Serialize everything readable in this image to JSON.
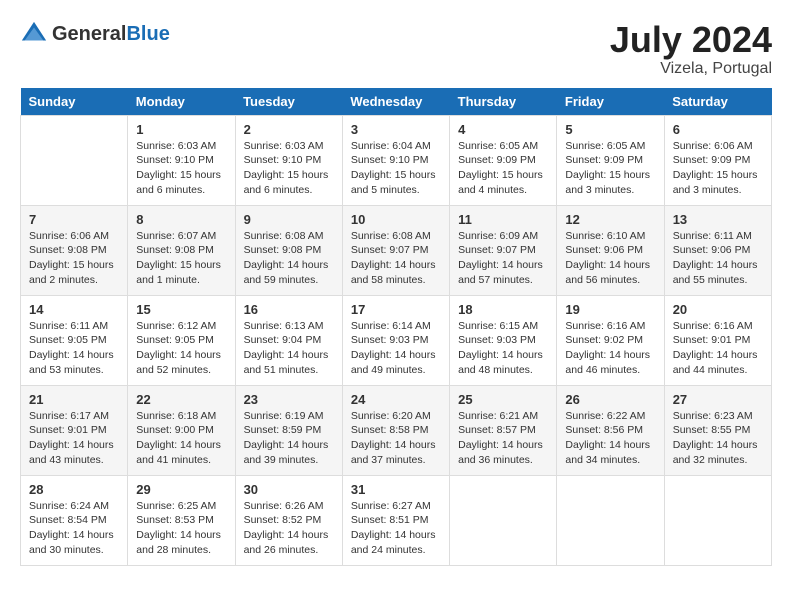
{
  "header": {
    "logo_general": "General",
    "logo_blue": "Blue",
    "month_year": "July 2024",
    "location": "Vizela, Portugal"
  },
  "weekdays": [
    "Sunday",
    "Monday",
    "Tuesday",
    "Wednesday",
    "Thursday",
    "Friday",
    "Saturday"
  ],
  "weeks": [
    [
      {
        "day": "",
        "info": ""
      },
      {
        "day": "1",
        "info": "Sunrise: 6:03 AM\nSunset: 9:10 PM\nDaylight: 15 hours\nand 6 minutes."
      },
      {
        "day": "2",
        "info": "Sunrise: 6:03 AM\nSunset: 9:10 PM\nDaylight: 15 hours\nand 6 minutes."
      },
      {
        "day": "3",
        "info": "Sunrise: 6:04 AM\nSunset: 9:10 PM\nDaylight: 15 hours\nand 5 minutes."
      },
      {
        "day": "4",
        "info": "Sunrise: 6:05 AM\nSunset: 9:09 PM\nDaylight: 15 hours\nand 4 minutes."
      },
      {
        "day": "5",
        "info": "Sunrise: 6:05 AM\nSunset: 9:09 PM\nDaylight: 15 hours\nand 3 minutes."
      },
      {
        "day": "6",
        "info": "Sunrise: 6:06 AM\nSunset: 9:09 PM\nDaylight: 15 hours\nand 3 minutes."
      }
    ],
    [
      {
        "day": "7",
        "info": "Sunrise: 6:06 AM\nSunset: 9:08 PM\nDaylight: 15 hours\nand 2 minutes."
      },
      {
        "day": "8",
        "info": "Sunrise: 6:07 AM\nSunset: 9:08 PM\nDaylight: 15 hours\nand 1 minute."
      },
      {
        "day": "9",
        "info": "Sunrise: 6:08 AM\nSunset: 9:08 PM\nDaylight: 14 hours\nand 59 minutes."
      },
      {
        "day": "10",
        "info": "Sunrise: 6:08 AM\nSunset: 9:07 PM\nDaylight: 14 hours\nand 58 minutes."
      },
      {
        "day": "11",
        "info": "Sunrise: 6:09 AM\nSunset: 9:07 PM\nDaylight: 14 hours\nand 57 minutes."
      },
      {
        "day": "12",
        "info": "Sunrise: 6:10 AM\nSunset: 9:06 PM\nDaylight: 14 hours\nand 56 minutes."
      },
      {
        "day": "13",
        "info": "Sunrise: 6:11 AM\nSunset: 9:06 PM\nDaylight: 14 hours\nand 55 minutes."
      }
    ],
    [
      {
        "day": "14",
        "info": "Sunrise: 6:11 AM\nSunset: 9:05 PM\nDaylight: 14 hours\nand 53 minutes."
      },
      {
        "day": "15",
        "info": "Sunrise: 6:12 AM\nSunset: 9:05 PM\nDaylight: 14 hours\nand 52 minutes."
      },
      {
        "day": "16",
        "info": "Sunrise: 6:13 AM\nSunset: 9:04 PM\nDaylight: 14 hours\nand 51 minutes."
      },
      {
        "day": "17",
        "info": "Sunrise: 6:14 AM\nSunset: 9:03 PM\nDaylight: 14 hours\nand 49 minutes."
      },
      {
        "day": "18",
        "info": "Sunrise: 6:15 AM\nSunset: 9:03 PM\nDaylight: 14 hours\nand 48 minutes."
      },
      {
        "day": "19",
        "info": "Sunrise: 6:16 AM\nSunset: 9:02 PM\nDaylight: 14 hours\nand 46 minutes."
      },
      {
        "day": "20",
        "info": "Sunrise: 6:16 AM\nSunset: 9:01 PM\nDaylight: 14 hours\nand 44 minutes."
      }
    ],
    [
      {
        "day": "21",
        "info": "Sunrise: 6:17 AM\nSunset: 9:01 PM\nDaylight: 14 hours\nand 43 minutes."
      },
      {
        "day": "22",
        "info": "Sunrise: 6:18 AM\nSunset: 9:00 PM\nDaylight: 14 hours\nand 41 minutes."
      },
      {
        "day": "23",
        "info": "Sunrise: 6:19 AM\nSunset: 8:59 PM\nDaylight: 14 hours\nand 39 minutes."
      },
      {
        "day": "24",
        "info": "Sunrise: 6:20 AM\nSunset: 8:58 PM\nDaylight: 14 hours\nand 37 minutes."
      },
      {
        "day": "25",
        "info": "Sunrise: 6:21 AM\nSunset: 8:57 PM\nDaylight: 14 hours\nand 36 minutes."
      },
      {
        "day": "26",
        "info": "Sunrise: 6:22 AM\nSunset: 8:56 PM\nDaylight: 14 hours\nand 34 minutes."
      },
      {
        "day": "27",
        "info": "Sunrise: 6:23 AM\nSunset: 8:55 PM\nDaylight: 14 hours\nand 32 minutes."
      }
    ],
    [
      {
        "day": "28",
        "info": "Sunrise: 6:24 AM\nSunset: 8:54 PM\nDaylight: 14 hours\nand 30 minutes."
      },
      {
        "day": "29",
        "info": "Sunrise: 6:25 AM\nSunset: 8:53 PM\nDaylight: 14 hours\nand 28 minutes."
      },
      {
        "day": "30",
        "info": "Sunrise: 6:26 AM\nSunset: 8:52 PM\nDaylight: 14 hours\nand 26 minutes."
      },
      {
        "day": "31",
        "info": "Sunrise: 6:27 AM\nSunset: 8:51 PM\nDaylight: 14 hours\nand 24 minutes."
      },
      {
        "day": "",
        "info": ""
      },
      {
        "day": "",
        "info": ""
      },
      {
        "day": "",
        "info": ""
      }
    ]
  ]
}
